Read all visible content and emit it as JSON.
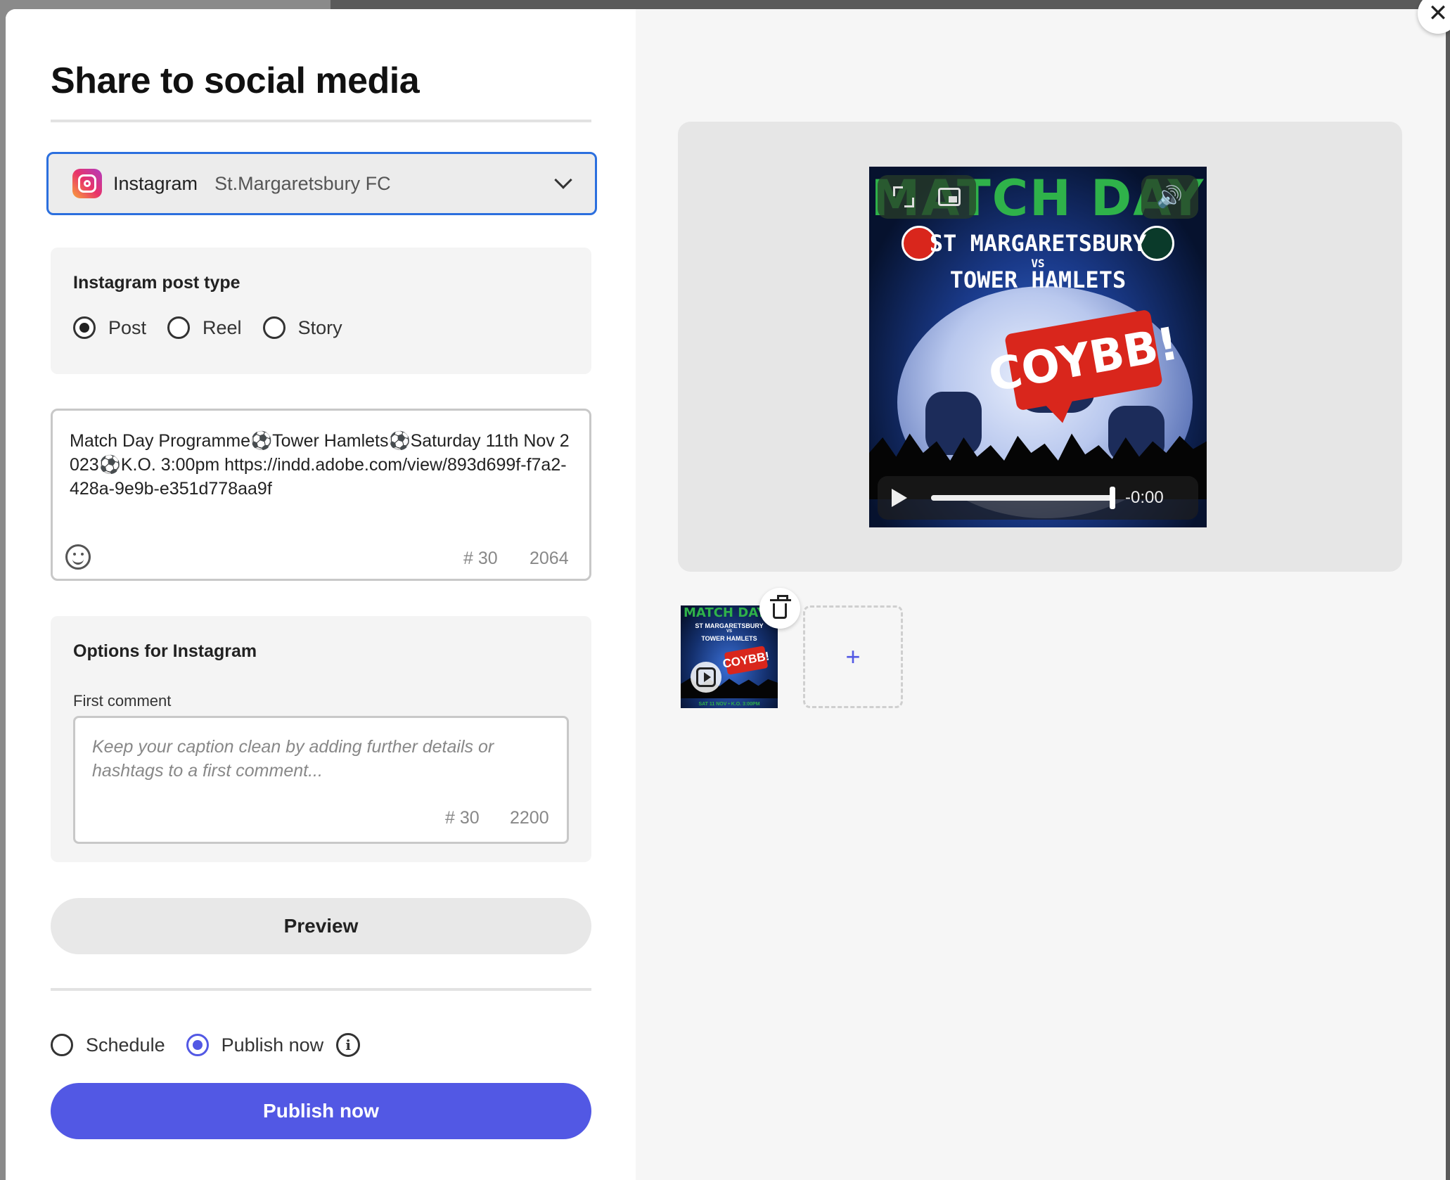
{
  "dialog": {
    "title": "Share to social media"
  },
  "account": {
    "platform": "Instagram",
    "name": "St.Margaretsbury FC"
  },
  "post_type": {
    "heading": "Instagram post type",
    "options": [
      {
        "label": "Post",
        "selected": true
      },
      {
        "label": "Reel",
        "selected": false
      },
      {
        "label": "Story",
        "selected": false
      }
    ]
  },
  "caption": {
    "text": "Match Day Programme⚽Tower Hamlets⚽Saturday 11th Nov 2023⚽K.O. 3:00pm https://indd.adobe.com/view/893d699f-f7a2-428a-9e9b-e351d778aa9f",
    "hashtag_count": "# 30",
    "char_count": "2064"
  },
  "options": {
    "heading": "Options for Instagram",
    "first_comment_label": "First comment",
    "first_comment_placeholder": "Keep your caption clean by adding further details or hashtags to a first comment...",
    "hashtag_count": "# 30",
    "char_count": "2200"
  },
  "buttons": {
    "preview": "Preview",
    "publish": "Publish now"
  },
  "timing": {
    "schedule_label": "Schedule",
    "publish_now_label": "Publish now",
    "selected": "publish_now"
  },
  "media": {
    "player_time": "-0:00",
    "progress": 1.0,
    "image_title": "MATCH DAY",
    "team_home": "ST MARGARETSBURY",
    "vs": "VS",
    "team_away": "TOWER HAMLETS",
    "slogan": "COYBB!",
    "thumb_footer": "SAT 11 NOV • K.O. 3:00PM",
    "add_symbol": "+"
  },
  "icons": {
    "close": "close-icon",
    "dropdown": "chevron-down-icon",
    "emoji": "emoji-icon",
    "info": "info-icon",
    "trash": "trash-icon",
    "fullscreen": "expand-icon",
    "pip": "picture-in-picture-icon",
    "volume": "volume-icon",
    "play": "play-icon"
  },
  "colors": {
    "accent": "#5258e4",
    "focus_border": "#2b6fde"
  }
}
